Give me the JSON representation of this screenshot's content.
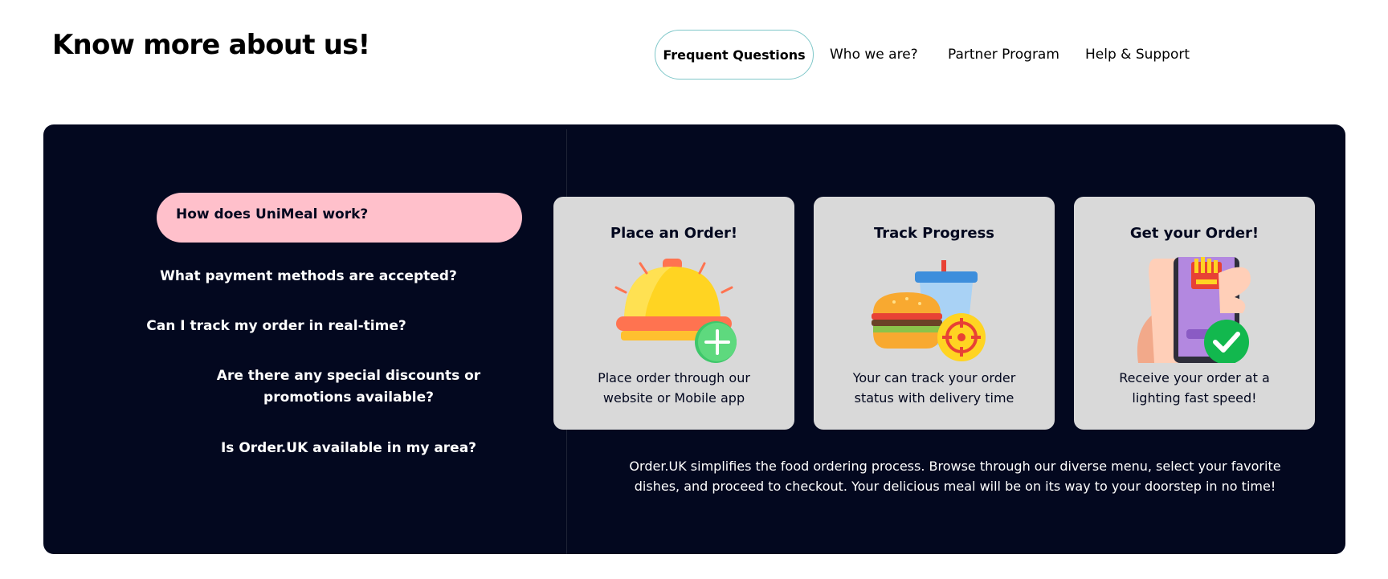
{
  "page_title": "Know more about us!",
  "nav": {
    "tabs": [
      {
        "label": "Frequent Questions"
      },
      {
        "label": "Who we are?"
      },
      {
        "label": "Partner Program"
      },
      {
        "label": "Help & Support"
      }
    ]
  },
  "faq": {
    "questions": [
      {
        "label": "How does UniMeal work?"
      },
      {
        "label": "What payment methods are accepted?"
      },
      {
        "label": "Can I track my order in real-time?"
      },
      {
        "label": "Are there any special discounts or\npromotions available?"
      },
      {
        "label": "Is Order.UK available in my area?"
      }
    ]
  },
  "cards": [
    {
      "title": "Place an Order!",
      "description": "Place order through our website or Mobile app",
      "icon": "food-cloche-add-icon"
    },
    {
      "title": "Track Progress",
      "description": "Your can track your order status with delivery time",
      "icon": "burger-drink-target-icon"
    },
    {
      "title": "Get your Order!",
      "description": "Receive your order at a lighting fast speed!",
      "icon": "phone-order-check-icon"
    }
  ],
  "summary": "Order.UK simplifies the food ordering process. Browse through our diverse menu, select your favorite dishes, and proceed to checkout. Your delicious meal will be on its way to your doorstep in no time!",
  "colors": {
    "panel_bg": "#03081F",
    "active_question_bg": "#FFC0CB",
    "card_bg": "#D9D9D9",
    "active_tab_border": "#7FC7C9"
  }
}
